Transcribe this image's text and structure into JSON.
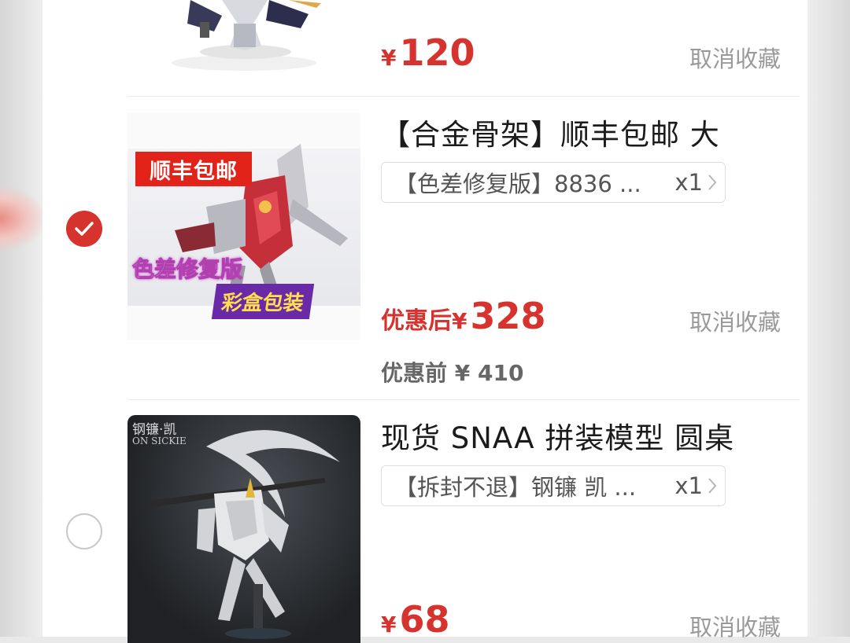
{
  "items": [
    {
      "price_prefix": "",
      "currency": "¥",
      "price": "120",
      "cancel_label": "取消收藏",
      "selected": false
    },
    {
      "title": "【合金骨架】顺丰包邮 大",
      "sku_text": "【色差修复版】8836 ...",
      "quantity": "x1",
      "price_prefix": "优惠后",
      "currency": "¥",
      "price": "328",
      "original_price": "优惠前 ¥ 410",
      "cancel_label": "取消收藏",
      "selected": true,
      "image_tags": {
        "shipping": "顺丰包邮",
        "version": "色差修复版",
        "box": "彩盒包装"
      }
    },
    {
      "title": "现货 SNAA 拼装模型 圆桌",
      "sku_text": "【拆封不退】钢镰 凯 ...",
      "quantity": "x1",
      "price_prefix": "",
      "currency": "¥",
      "price": "68",
      "cancel_label": "取消收藏",
      "selected": false,
      "image_tags": {
        "brand": "钢镰·凯",
        "brand_en": "ON SICKIE"
      }
    }
  ]
}
